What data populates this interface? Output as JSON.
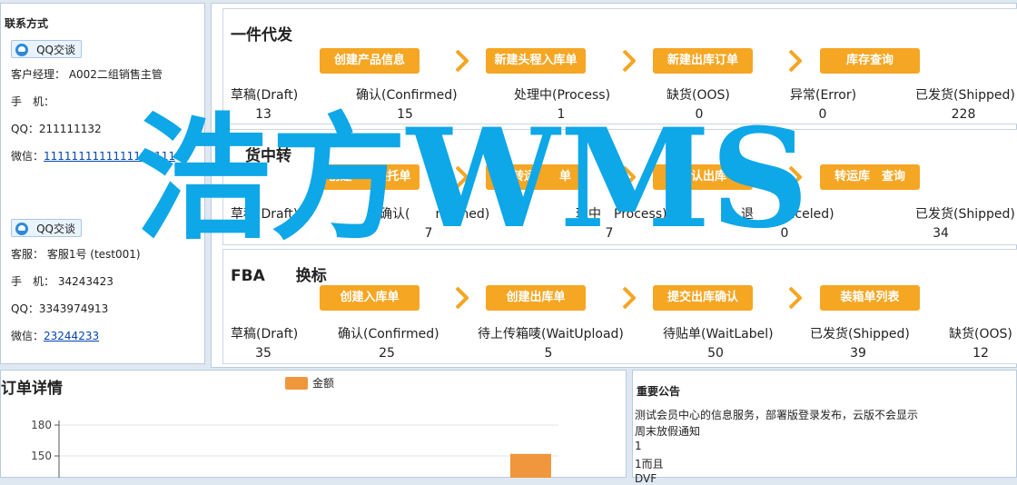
{
  "contact": {
    "title": "联系方式",
    "qq_button_label": "QQ交谈",
    "manager": {
      "customer_manager": "客户经理： A002二组销售主管",
      "phone": "手　机：",
      "qq": "QQ：211111132",
      "wechat_label": "微信：",
      "wechat_value": "1111111111111111111"
    },
    "service": {
      "name": "客服：  客服1号 (test001)",
      "phone": "手　机：  34243423",
      "qq": "QQ：3343974913",
      "wechat_label": "微信：",
      "wechat_value": "23244233"
    }
  },
  "sections": [
    {
      "title": "一件代发",
      "buttons": [
        "创建产品信息",
        "新建头程入库单",
        "新建出库订单",
        "库存查询"
      ],
      "stats": [
        {
          "label": "草稿(Draft)",
          "value": "13"
        },
        {
          "label": "确认(Confirmed)",
          "value": "15"
        },
        {
          "label": "处理中(Process)",
          "value": "1"
        },
        {
          "label": "缺货(OOS)",
          "value": "0"
        },
        {
          "label": "异常(Error)",
          "value": "0"
        },
        {
          "label": "已发货(Shipped)",
          "value": "228"
        }
      ]
    },
    {
      "title": "货中转",
      "buttons": [
        "创建",
        "委托单",
        "建转运",
        "单",
        "确认出库",
        "转运库",
        "查询"
      ],
      "stats": [
        {
          "label": "草稿(Draft)",
          "value": ""
        },
        {
          "label": "确认(",
          "value": "7"
        },
        {
          "label": "nfirmed)",
          "value": ""
        },
        {
          "label": "理中",
          "value": ""
        },
        {
          "label": "Process)",
          "value": "7"
        },
        {
          "label": "退",
          "value": ""
        },
        {
          "label": "anceled)",
          "value": "0"
        },
        {
          "label": "已发货(Shipped)",
          "value": "34"
        }
      ]
    },
    {
      "title": "FBA",
      "title2": "换标",
      "buttons": [
        "创建入库单",
        "创建出库单",
        "提交出库确认",
        "装箱单列表"
      ],
      "stats": [
        {
          "label": "草稿(Draft)",
          "value": "35"
        },
        {
          "label": "确认(Confirmed)",
          "value": "25"
        },
        {
          "label": "待上传箱唛(WaitUpload)",
          "value": "5"
        },
        {
          "label": "待贴单(WaitLabel)",
          "value": "50"
        },
        {
          "label": "已发货(Shipped)",
          "value": "39"
        },
        {
          "label": "缺货(OOS)",
          "value": "12"
        }
      ]
    }
  ],
  "order": {
    "title": "订单详情",
    "legend": "金额",
    "legend_color": "#f0963c"
  },
  "chart_data": {
    "type": "bar",
    "title": "订单详情",
    "series": [
      {
        "name": "金额",
        "values": [
          0,
          0,
          0,
          0,
          0,
          0,
          0,
          0,
          152
        ]
      }
    ],
    "y_ticks": [
      "180",
      "150"
    ],
    "ylim": [
      0,
      180
    ],
    "color": "#f0963c",
    "grid": true
  },
  "notice": {
    "title": "重要公告",
    "lines": [
      "测试会员中心的信息服务，部署版登录发布，云版不会显示",
      "周末放假通知",
      "1",
      "1而且",
      "DVF"
    ]
  },
  "watermark": "浩方WMS"
}
